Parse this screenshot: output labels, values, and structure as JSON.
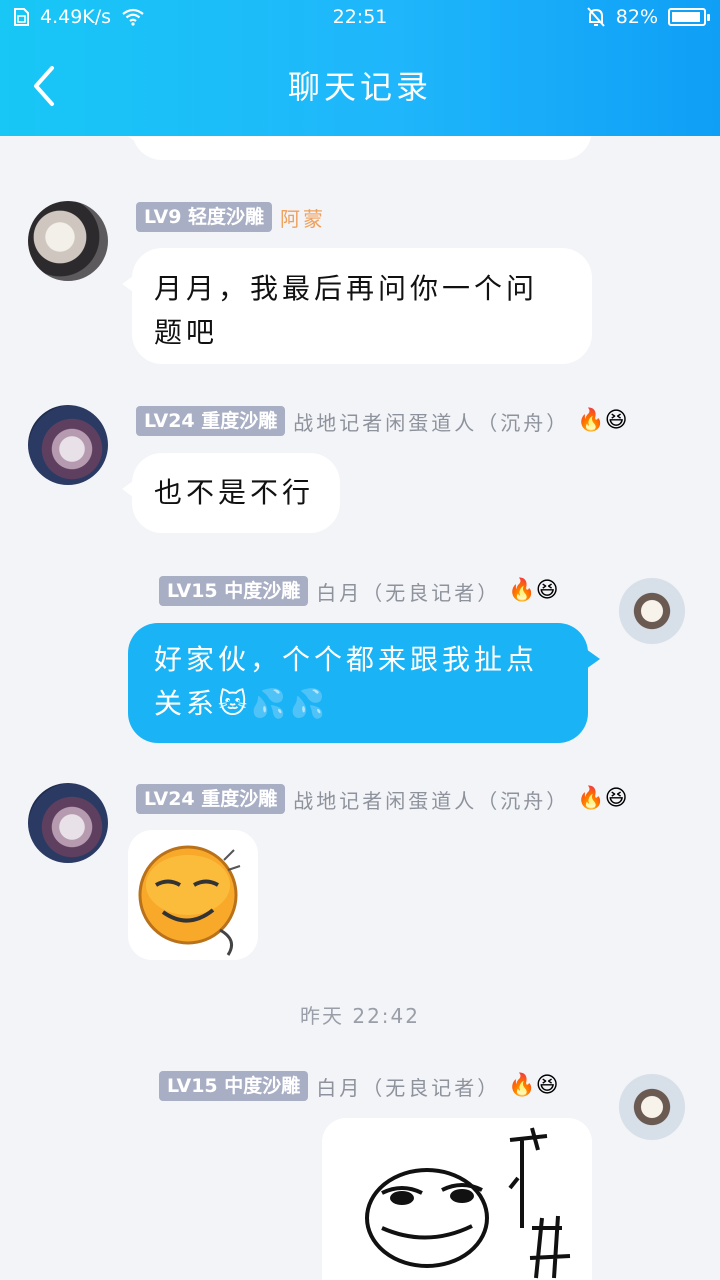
{
  "status": {
    "network_speed": "4.49K/s",
    "time": "22:51",
    "battery": "82%",
    "battery_level": 0.82
  },
  "header": {
    "title": "聊天记录"
  },
  "messages": [
    {
      "badge": "LV9 轻度沙雕",
      "nick": "阿蒙",
      "text_line1": "月月，我最后再问你一个问",
      "text_line2": "题吧"
    },
    {
      "badge": "LV24 重度沙雕",
      "nick": "战地记者闲蛋道人（沉舟）",
      "emojis": "🔥😆",
      "text": "也不是不行"
    },
    {
      "badge": "LV15 中度沙雕",
      "nick": "白月（无良记者）",
      "emojis": "🔥😆",
      "text_line1": "好家伙，个个都来跟我扯点",
      "text_line2": "关系🐱💦💦"
    },
    {
      "badge": "LV24 重度沙雕",
      "nick": "战地记者闲蛋道人（沉舟）",
      "emojis": "🔥😆"
    },
    {
      "badge": "LV15 中度沙雕",
      "nick": "白月（无良记者）",
      "emojis": "🔥😆"
    }
  ],
  "timestamp": "昨天 22:42"
}
